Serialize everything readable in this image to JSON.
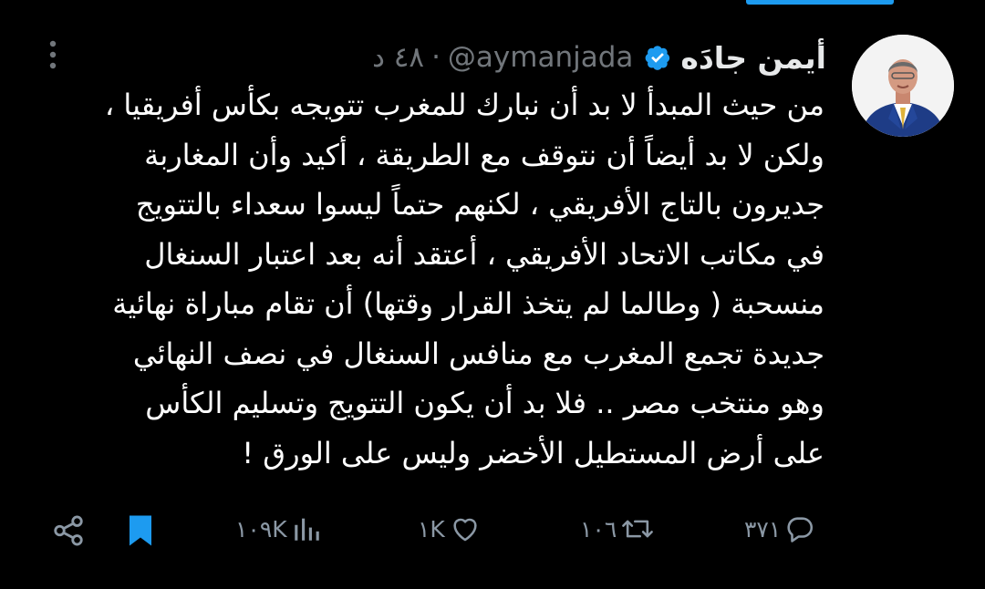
{
  "tweet": {
    "author_name": "أيمن جادَه",
    "handle": "@aymanjada",
    "separator": "·",
    "time": "٤٨ د",
    "text_lines": [
      "من حيث المبدأ لا بد أن نبارك للمغرب تتويجه بكأس أفريقيا ،",
      "ولكن لا بد أيضاً أن نتوقف مع الطريقة ، أكيد وأن المغاربة",
      "جديرون بالتاج الأفريقي ، لكنهم حتماً ليسوا سعداء بالتتويج",
      "في مكاتب الاتحاد الأفريقي ، أعتقد أنه بعد اعتبار السنغال",
      "منسحبة ( وطالما لم يتخذ القرار وقتها) أن تقام مباراة نهائية",
      "جديدة تجمع المغرب مع منافس السنغال في نصف النهائي",
      "وهو منتخب مصر .. فلا بد أن يكون التتويج وتسليم الكأس",
      "على أرض المستطيل الأخضر وليس على الورق !"
    ]
  },
  "actions": {
    "replies": "٣٧١",
    "reposts": "١٠٦",
    "likes": "١K",
    "views": "١٠٩K"
  },
  "colors": {
    "background": "#000000",
    "text": "#e7e9ea",
    "muted": "#71767b",
    "icon": "#8b98a5",
    "accent": "#1d9bf0"
  },
  "icons": {
    "verified": "verified-badge-icon",
    "more": "more-vertical-icon",
    "reply": "reply-icon",
    "repost": "repost-icon",
    "like": "like-heart-icon",
    "views": "views-bar-chart-icon",
    "bookmark": "bookmark-icon",
    "share": "share-icon"
  }
}
